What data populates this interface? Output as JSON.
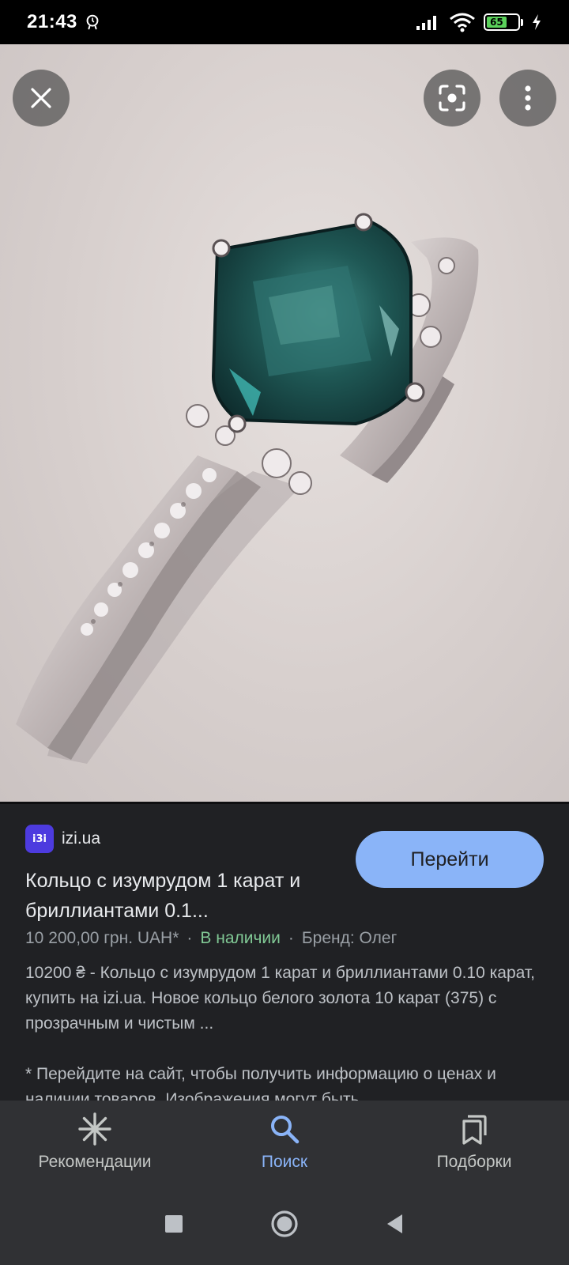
{
  "status_bar": {
    "time": "21:43",
    "battery_level": "65",
    "icons": [
      "alarm-icon",
      "signal-icon",
      "wifi-icon",
      "battery-icon",
      "charging-icon"
    ]
  },
  "image_viewer": {
    "close_icon": "close-icon",
    "lens_icon": "google-lens-icon",
    "menu_icon": "more-vert-icon"
  },
  "result": {
    "favicon_text": "i3i",
    "source": "izi.ua",
    "goto_label": "Перейти",
    "title": "Кольцо с изумрудом 1 карат и бриллиантами 0.1...",
    "price": "10 200,00 грн. UAH*",
    "availability": "В наличии",
    "brand": "Бренд: Олег",
    "description": "10200 ₴ - Кольцо с изумрудом 1 карат и бриллиантами 0.10 карат, купить на izi.ua. Новое кольцо белого золота 10 карат (375) с прозрачным и чистым ...",
    "note": "* Перейдите на сайт, чтобы получить информацию о ценах и наличии товаров. Изображения могут быть"
  },
  "bottom_nav": [
    {
      "label": "Рекомендации",
      "icon": "sparkle-icon",
      "active": false
    },
    {
      "label": "Поиск",
      "icon": "search-icon",
      "active": true
    },
    {
      "label": "Подборки",
      "icon": "collections-icon",
      "active": false
    }
  ],
  "colors": {
    "accent": "#8ab4f8",
    "in_stock": "#81c995",
    "panel_bg": "#202124",
    "nav_bg": "#303134"
  }
}
